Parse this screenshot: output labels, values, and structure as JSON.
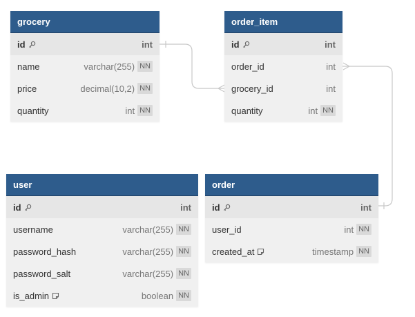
{
  "tables": {
    "grocery": {
      "name": "grocery",
      "columns": [
        {
          "name": "id",
          "type": "int",
          "pk": true,
          "nn": ""
        },
        {
          "name": "name",
          "type": "varchar(255)",
          "pk": false,
          "nn": "NN"
        },
        {
          "name": "price",
          "type": "decimal(10,2)",
          "pk": false,
          "nn": "NN"
        },
        {
          "name": "quantity",
          "type": "int",
          "pk": false,
          "nn": "NN"
        }
      ]
    },
    "order_item": {
      "name": "order_item",
      "columns": [
        {
          "name": "id",
          "type": "int",
          "pk": true,
          "nn": ""
        },
        {
          "name": "order_id",
          "type": "int",
          "pk": false,
          "nn": ""
        },
        {
          "name": "grocery_id",
          "type": "int",
          "pk": false,
          "nn": ""
        },
        {
          "name": "quantity",
          "type": "int",
          "pk": false,
          "nn": "NN"
        }
      ]
    },
    "user": {
      "name": "user",
      "columns": [
        {
          "name": "id",
          "type": "int",
          "pk": true,
          "nn": ""
        },
        {
          "name": "username",
          "type": "varchar(255)",
          "pk": false,
          "nn": "NN"
        },
        {
          "name": "password_hash",
          "type": "varchar(255)",
          "pk": false,
          "nn": "NN"
        },
        {
          "name": "password_salt",
          "type": "varchar(255)",
          "pk": false,
          "nn": "NN"
        },
        {
          "name": "is_admin",
          "type": "boolean",
          "pk": false,
          "nn": "NN"
        }
      ]
    },
    "order": {
      "name": "order",
      "columns": [
        {
          "name": "id",
          "type": "int",
          "pk": true,
          "nn": ""
        },
        {
          "name": "user_id",
          "type": "int",
          "pk": false,
          "nn": "NN"
        },
        {
          "name": "created_at",
          "type": "timestamp",
          "pk": false,
          "nn": "NN"
        }
      ]
    }
  },
  "colors": {
    "header": "#2e5c8c",
    "body": "#f0f0f0",
    "pk_row": "#e6e6e6",
    "connector": "#c8c8c8"
  },
  "icons": {
    "primary_key": "key-icon",
    "note": "note-icon"
  }
}
